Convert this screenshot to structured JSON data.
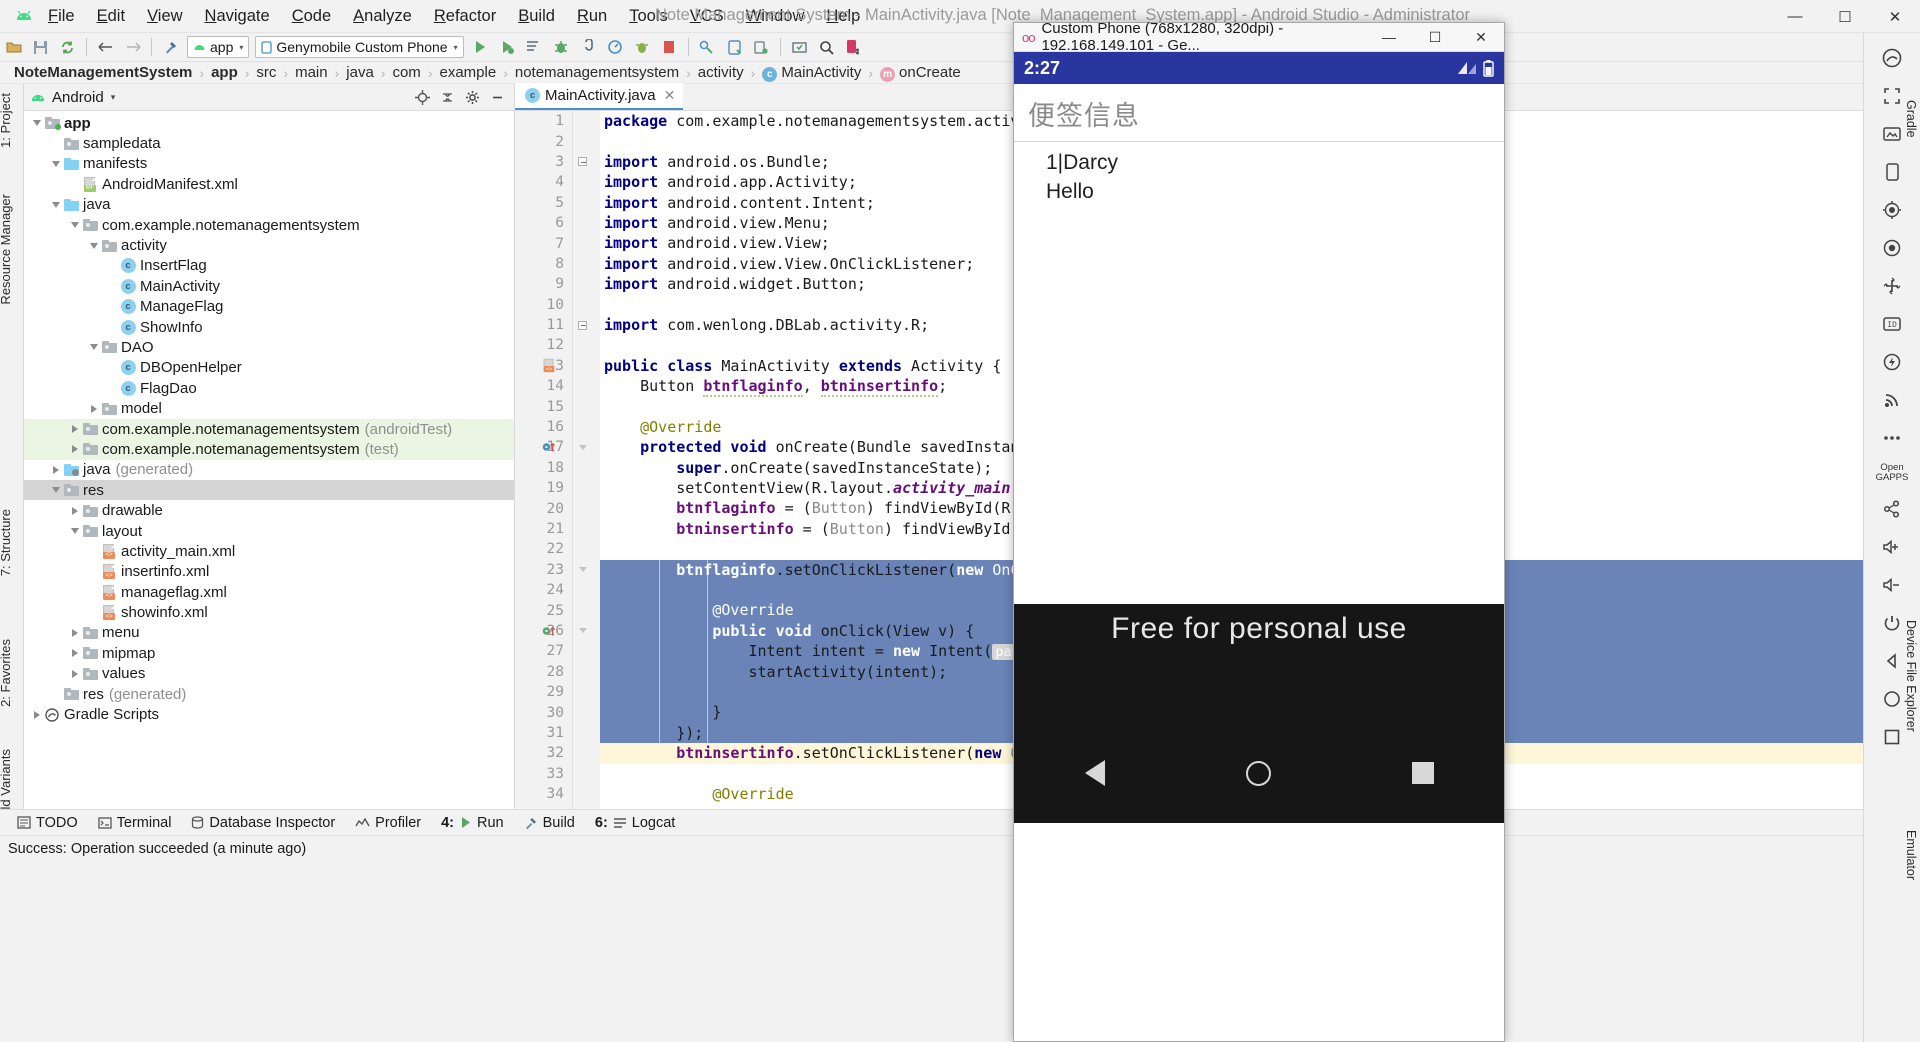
{
  "titlebar": {
    "menus": [
      "File",
      "Edit",
      "View",
      "Navigate",
      "Code",
      "Analyze",
      "Refactor",
      "Build",
      "Run",
      "Tools",
      "VCS",
      "Window",
      "Help"
    ],
    "title": "Note Management System - MainActivity.java [Note_Management_System.app] - Android Studio - Administrator",
    "minimize": "—",
    "maximize": "☐",
    "close": "✕"
  },
  "toolbar": {
    "module_combo": "app",
    "device_combo": "Genymobile Custom Phone",
    "caret": "▾"
  },
  "breadcrumb": {
    "items": [
      {
        "label": "NoteManagementSystem",
        "bold": true,
        "badge": ""
      },
      {
        "label": "app",
        "bold": true,
        "badge": ""
      },
      {
        "label": "src",
        "bold": false,
        "badge": ""
      },
      {
        "label": "main",
        "bold": false,
        "badge": ""
      },
      {
        "label": "java",
        "bold": false,
        "badge": ""
      },
      {
        "label": "com",
        "bold": false,
        "badge": ""
      },
      {
        "label": "example",
        "bold": false,
        "badge": ""
      },
      {
        "label": "notemanagementsystem",
        "bold": false,
        "badge": ""
      },
      {
        "label": "activity",
        "bold": false,
        "badge": ""
      },
      {
        "label": "MainActivity",
        "bold": false,
        "badge": "c"
      },
      {
        "label": "onCreate",
        "bold": false,
        "badge": "m"
      }
    ],
    "separator": "›"
  },
  "left_rail": {
    "project_label": "1: Project",
    "resource_manager_label": "Resource Manager",
    "structure_label": "7: Structure",
    "favorites_label": "2: Favorites",
    "build_variants_label": "Build Variants"
  },
  "project_panel": {
    "title": "Android",
    "caret": "▾",
    "tree": [
      {
        "label": "app",
        "indent": 0,
        "twisty": "down",
        "icon": "folder-module-green",
        "bold": true,
        "sub": "",
        "sel": ""
      },
      {
        "label": "sampledata",
        "indent": 1,
        "twisty": "none",
        "icon": "folder-gray-plain",
        "bold": false,
        "sub": "",
        "sel": ""
      },
      {
        "label": "manifests",
        "indent": 1,
        "twisty": "down",
        "icon": "folder-blue",
        "bold": false,
        "sub": "",
        "sel": ""
      },
      {
        "label": "AndroidManifest.xml",
        "indent": 2,
        "twisty": "none",
        "icon": "file-manifest",
        "bold": false,
        "sub": "",
        "sel": ""
      },
      {
        "label": "java",
        "indent": 1,
        "twisty": "down",
        "icon": "folder-blue",
        "bold": false,
        "sub": "",
        "sel": ""
      },
      {
        "label": "com.example.notemanagementsystem",
        "indent": 2,
        "twisty": "down",
        "icon": "folder-pkg",
        "bold": false,
        "sub": "",
        "sel": ""
      },
      {
        "label": "activity",
        "indent": 3,
        "twisty": "down",
        "icon": "folder-pkg",
        "bold": false,
        "sub": "",
        "sel": ""
      },
      {
        "label": "InsertFlag",
        "indent": 4,
        "twisty": "none",
        "icon": "class",
        "bold": false,
        "sub": "",
        "sel": ""
      },
      {
        "label": "MainActivity",
        "indent": 4,
        "twisty": "none",
        "icon": "class",
        "bold": false,
        "sub": "",
        "sel": ""
      },
      {
        "label": "ManageFlag",
        "indent": 4,
        "twisty": "none",
        "icon": "class",
        "bold": false,
        "sub": "",
        "sel": ""
      },
      {
        "label": "ShowInfo",
        "indent": 4,
        "twisty": "none",
        "icon": "class",
        "bold": false,
        "sub": "",
        "sel": ""
      },
      {
        "label": "DAO",
        "indent": 3,
        "twisty": "down",
        "icon": "folder-pkg",
        "bold": false,
        "sub": "",
        "sel": ""
      },
      {
        "label": "DBOpenHelper",
        "indent": 4,
        "twisty": "none",
        "icon": "class",
        "bold": false,
        "sub": "",
        "sel": ""
      },
      {
        "label": "FlagDao",
        "indent": 4,
        "twisty": "none",
        "icon": "class",
        "bold": false,
        "sub": "",
        "sel": ""
      },
      {
        "label": "model",
        "indent": 3,
        "twisty": "right",
        "icon": "folder-pkg",
        "bold": false,
        "sub": "",
        "sel": ""
      },
      {
        "label": "com.example.notemanagementsystem",
        "indent": 2,
        "twisty": "right",
        "icon": "folder-pkg",
        "bold": false,
        "sub": "(androidTest)",
        "sel": "green"
      },
      {
        "label": "com.example.notemanagementsystem",
        "indent": 2,
        "twisty": "right",
        "icon": "folder-pkg",
        "bold": false,
        "sub": "(test)",
        "sel": "green"
      },
      {
        "label": "java",
        "indent": 1,
        "twisty": "right",
        "icon": "folder-generated",
        "bold": false,
        "sub": "(generated)",
        "sel": ""
      },
      {
        "label": "res",
        "indent": 1,
        "twisty": "down",
        "icon": "folder-res",
        "bold": false,
        "sub": "",
        "sel": "gray"
      },
      {
        "label": "drawable",
        "indent": 2,
        "twisty": "right",
        "icon": "folder-pkg",
        "bold": false,
        "sub": "",
        "sel": ""
      },
      {
        "label": "layout",
        "indent": 2,
        "twisty": "down",
        "icon": "folder-pkg",
        "bold": false,
        "sub": "",
        "sel": ""
      },
      {
        "label": "activity_main.xml",
        "indent": 3,
        "twisty": "none",
        "icon": "file-xml",
        "bold": false,
        "sub": "",
        "sel": ""
      },
      {
        "label": "insertinfo.xml",
        "indent": 3,
        "twisty": "none",
        "icon": "file-xml",
        "bold": false,
        "sub": "",
        "sel": ""
      },
      {
        "label": "manageflag.xml",
        "indent": 3,
        "twisty": "none",
        "icon": "file-xml",
        "bold": false,
        "sub": "",
        "sel": ""
      },
      {
        "label": "showinfo.xml",
        "indent": 3,
        "twisty": "none",
        "icon": "file-xml",
        "bold": false,
        "sub": "",
        "sel": ""
      },
      {
        "label": "menu",
        "indent": 2,
        "twisty": "right",
        "icon": "folder-pkg",
        "bold": false,
        "sub": "",
        "sel": ""
      },
      {
        "label": "mipmap",
        "indent": 2,
        "twisty": "right",
        "icon": "folder-pkg",
        "bold": false,
        "sub": "",
        "sel": ""
      },
      {
        "label": "values",
        "indent": 2,
        "twisty": "right",
        "icon": "folder-pkg",
        "bold": false,
        "sub": "",
        "sel": ""
      },
      {
        "label": "res",
        "indent": 1,
        "twisty": "none",
        "icon": "folder-res",
        "bold": false,
        "sub": "(generated)",
        "sel": ""
      },
      {
        "label": "Gradle Scripts",
        "indent": 0,
        "twisty": "right",
        "icon": "gradle",
        "bold": false,
        "sub": "",
        "sel": ""
      }
    ]
  },
  "editor": {
    "tab_label": "MainActivity.java",
    "tab_close": "✕",
    "lines": [
      {
        "n": 1,
        "html": "<span class=\"kw\">package</span> com.example.notemanagementsystem.activity;",
        "hl": "",
        "fold": "",
        "mark": ""
      },
      {
        "n": 2,
        "html": "",
        "hl": "",
        "fold": "",
        "mark": ""
      },
      {
        "n": 3,
        "html": "<span class=\"kw\">import</span> android.os.Bundle;",
        "hl": "",
        "fold": "minus-top",
        "mark": ""
      },
      {
        "n": 4,
        "html": "<span class=\"kw\">import</span> android.app.Activity;",
        "hl": "",
        "fold": "",
        "mark": ""
      },
      {
        "n": 5,
        "html": "<span class=\"kw\">import</span> android.content.Intent;",
        "hl": "",
        "fold": "",
        "mark": ""
      },
      {
        "n": 6,
        "html": "<span class=\"kw\">import</span> android.view.Menu;",
        "hl": "",
        "fold": "",
        "mark": ""
      },
      {
        "n": 7,
        "html": "<span class=\"kw\">import</span> android.view.View;",
        "hl": "",
        "fold": "",
        "mark": ""
      },
      {
        "n": 8,
        "html": "<span class=\"kw\">import</span> android.view.View.OnClickListener;",
        "hl": "",
        "fold": "",
        "mark": ""
      },
      {
        "n": 9,
        "html": "<span class=\"kw\">import</span> android.widget.Button;",
        "hl": "",
        "fold": "",
        "mark": ""
      },
      {
        "n": 10,
        "html": "",
        "hl": "",
        "fold": "",
        "mark": ""
      },
      {
        "n": 11,
        "html": "<span class=\"kw\">import</span> com.wenlong.DBLab.activity.R;",
        "hl": "",
        "fold": "minus",
        "mark": ""
      },
      {
        "n": 12,
        "html": "",
        "hl": "",
        "fold": "",
        "mark": ""
      },
      {
        "n": 13,
        "html": "<span class=\"kw\">public class</span> MainActivity <span class=\"kw\">extends</span> Activity {",
        "hl": "",
        "fold": "",
        "mark": "xml"
      },
      {
        "n": 14,
        "html": "    Button <span class=\"fieldv wavy\">btnflaginfo</span>, <span class=\"fieldv wavy\">btninsertinfo</span>;",
        "hl": "",
        "fold": "",
        "mark": ""
      },
      {
        "n": 15,
        "html": "",
        "hl": "",
        "fold": "",
        "mark": ""
      },
      {
        "n": 16,
        "html": "    <span class=\"anno\">@Override</span>",
        "hl": "",
        "fold": "",
        "mark": ""
      },
      {
        "n": 17,
        "html": "    <span class=\"kw\">protected void</span> onCreate(Bundle savedInstanceState) {",
        "hl": "",
        "fold": "tri",
        "mark": "run-blue"
      },
      {
        "n": 18,
        "html": "        <span class=\"kw\">super</span>.onCreate(savedInstanceState);",
        "hl": "",
        "fold": "",
        "mark": ""
      },
      {
        "n": 19,
        "html": "        setContentView(R.layout.<span class=\"statics\">activity_main</span>);",
        "hl": "",
        "fold": "",
        "mark": ""
      },
      {
        "n": 20,
        "html": "        <span class=\"fieldv\">btnflaginfo</span> = (<span class=\"gray\">Button</span>) findViewById(R.id.<span class=\"statics\">btnflaginfo</span>);",
        "hl": "",
        "fold": "",
        "mark": ""
      },
      {
        "n": 21,
        "html": "        <span class=\"fieldv\">btninsertinfo</span> = (<span class=\"gray\">Button</span>) findViewById(R.id.<span class=\"statics\">btninsertinfo</span>);",
        "hl": "",
        "fold": "",
        "mark": ""
      },
      {
        "n": 22,
        "html": "",
        "hl": "",
        "fold": "",
        "mark": ""
      },
      {
        "n": 23,
        "html": "        <span class=\"fieldv\">btnflaginfo</span>.setOnClickListener(<span class=\"kw\">new</span> <span class=\"gray\">OnClickListener</span>() {",
        "hl": "blue",
        "fold": "tri",
        "mark": ""
      },
      {
        "n": 24,
        "html": "",
        "hl": "blue",
        "fold": "",
        "mark": ""
      },
      {
        "n": 25,
        "html": "            <span class=\"anno\">@Override</span>",
        "hl": "blue",
        "fold": "",
        "mark": ""
      },
      {
        "n": 26,
        "html": "            <span class=\"kw\">public void</span> onClick(View v) {",
        "hl": "blue",
        "fold": "tri",
        "mark": "run-green"
      },
      {
        "n": 27,
        "html": "                Intent intent = <span class=\"kw\">new</span> Intent(<span class=\"hintbox\">packageContext:</span> M",
        "hl": "blue",
        "fold": "",
        "mark": ""
      },
      {
        "n": 28,
        "html": "                startActivity(intent);",
        "hl": "blue",
        "fold": "",
        "mark": ""
      },
      {
        "n": 29,
        "html": "",
        "hl": "blue",
        "fold": "",
        "mark": ""
      },
      {
        "n": 30,
        "html": "            }",
        "hl": "blue",
        "fold": "",
        "mark": ""
      },
      {
        "n": 31,
        "html": "        });",
        "hl": "blue",
        "fold": "",
        "mark": ""
      },
      {
        "n": 32,
        "html": "        <span class=\"fieldv\">btninsertinfo</span>.setOnClickListener(<span class=\"kw\">new</span> <span class=\"gray\">OnClickListener</span>",
        "hl": "yellow",
        "fold": "",
        "mark": ""
      },
      {
        "n": 33,
        "html": "",
        "hl": "",
        "fold": "",
        "mark": ""
      },
      {
        "n": 34,
        "html": "            <span class=\"anno\">@Override</span>",
        "hl": "",
        "fold": "",
        "mark": ""
      }
    ]
  },
  "bottom_tabs": [
    {
      "icon": "todo-icon",
      "label": "TODO",
      "num": ""
    },
    {
      "icon": "terminal-icon",
      "label": "Terminal",
      "num": ""
    },
    {
      "icon": "database-icon",
      "label": "Database Inspector",
      "num": ""
    },
    {
      "icon": "profiler-icon",
      "label": "Profiler",
      "num": ""
    },
    {
      "icon": "run-icon",
      "label": "Run",
      "num": "4:"
    },
    {
      "icon": "build-icon",
      "label": "Build",
      "num": ""
    },
    {
      "icon": "logcat-icon",
      "label": "Logcat",
      "num": "6:"
    }
  ],
  "statusbar": {
    "message": "Success: Operation succeeded (a minute ago)"
  },
  "right_strip": {
    "labels": {
      "gradle": "Gradle",
      "device_file_explorer": "Device File Explorer",
      "emulator": "Emulator"
    },
    "open_gapps": "Open GAPPS"
  },
  "emulator": {
    "window_title": "Custom Phone (768x1280, 320dpi) - 192.168.149.101 - Ge...",
    "minimize": "—",
    "maximize": "☐",
    "close": "✕",
    "clock": "2:27",
    "app_title": "便签信息",
    "list": [
      "1|Darcy",
      "Hello"
    ],
    "watermark": "Free for personal use"
  }
}
